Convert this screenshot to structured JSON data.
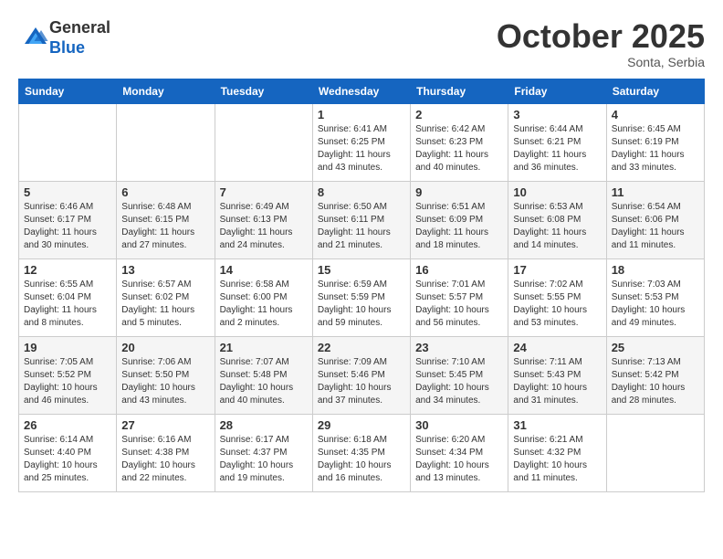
{
  "header": {
    "logo_line1": "General",
    "logo_line2": "Blue",
    "month_title": "October 2025",
    "location": "Sonta, Serbia"
  },
  "days_of_week": [
    "Sunday",
    "Monday",
    "Tuesday",
    "Wednesday",
    "Thursday",
    "Friday",
    "Saturday"
  ],
  "weeks": [
    [
      {
        "day": "",
        "info": ""
      },
      {
        "day": "",
        "info": ""
      },
      {
        "day": "",
        "info": ""
      },
      {
        "day": "1",
        "info": "Sunrise: 6:41 AM\nSunset: 6:25 PM\nDaylight: 11 hours\nand 43 minutes."
      },
      {
        "day": "2",
        "info": "Sunrise: 6:42 AM\nSunset: 6:23 PM\nDaylight: 11 hours\nand 40 minutes."
      },
      {
        "day": "3",
        "info": "Sunrise: 6:44 AM\nSunset: 6:21 PM\nDaylight: 11 hours\nand 36 minutes."
      },
      {
        "day": "4",
        "info": "Sunrise: 6:45 AM\nSunset: 6:19 PM\nDaylight: 11 hours\nand 33 minutes."
      }
    ],
    [
      {
        "day": "5",
        "info": "Sunrise: 6:46 AM\nSunset: 6:17 PM\nDaylight: 11 hours\nand 30 minutes."
      },
      {
        "day": "6",
        "info": "Sunrise: 6:48 AM\nSunset: 6:15 PM\nDaylight: 11 hours\nand 27 minutes."
      },
      {
        "day": "7",
        "info": "Sunrise: 6:49 AM\nSunset: 6:13 PM\nDaylight: 11 hours\nand 24 minutes."
      },
      {
        "day": "8",
        "info": "Sunrise: 6:50 AM\nSunset: 6:11 PM\nDaylight: 11 hours\nand 21 minutes."
      },
      {
        "day": "9",
        "info": "Sunrise: 6:51 AM\nSunset: 6:09 PM\nDaylight: 11 hours\nand 18 minutes."
      },
      {
        "day": "10",
        "info": "Sunrise: 6:53 AM\nSunset: 6:08 PM\nDaylight: 11 hours\nand 14 minutes."
      },
      {
        "day": "11",
        "info": "Sunrise: 6:54 AM\nSunset: 6:06 PM\nDaylight: 11 hours\nand 11 minutes."
      }
    ],
    [
      {
        "day": "12",
        "info": "Sunrise: 6:55 AM\nSunset: 6:04 PM\nDaylight: 11 hours\nand 8 minutes."
      },
      {
        "day": "13",
        "info": "Sunrise: 6:57 AM\nSunset: 6:02 PM\nDaylight: 11 hours\nand 5 minutes."
      },
      {
        "day": "14",
        "info": "Sunrise: 6:58 AM\nSunset: 6:00 PM\nDaylight: 11 hours\nand 2 minutes."
      },
      {
        "day": "15",
        "info": "Sunrise: 6:59 AM\nSunset: 5:59 PM\nDaylight: 10 hours\nand 59 minutes."
      },
      {
        "day": "16",
        "info": "Sunrise: 7:01 AM\nSunset: 5:57 PM\nDaylight: 10 hours\nand 56 minutes."
      },
      {
        "day": "17",
        "info": "Sunrise: 7:02 AM\nSunset: 5:55 PM\nDaylight: 10 hours\nand 53 minutes."
      },
      {
        "day": "18",
        "info": "Sunrise: 7:03 AM\nSunset: 5:53 PM\nDaylight: 10 hours\nand 49 minutes."
      }
    ],
    [
      {
        "day": "19",
        "info": "Sunrise: 7:05 AM\nSunset: 5:52 PM\nDaylight: 10 hours\nand 46 minutes."
      },
      {
        "day": "20",
        "info": "Sunrise: 7:06 AM\nSunset: 5:50 PM\nDaylight: 10 hours\nand 43 minutes."
      },
      {
        "day": "21",
        "info": "Sunrise: 7:07 AM\nSunset: 5:48 PM\nDaylight: 10 hours\nand 40 minutes."
      },
      {
        "day": "22",
        "info": "Sunrise: 7:09 AM\nSunset: 5:46 PM\nDaylight: 10 hours\nand 37 minutes."
      },
      {
        "day": "23",
        "info": "Sunrise: 7:10 AM\nSunset: 5:45 PM\nDaylight: 10 hours\nand 34 minutes."
      },
      {
        "day": "24",
        "info": "Sunrise: 7:11 AM\nSunset: 5:43 PM\nDaylight: 10 hours\nand 31 minutes."
      },
      {
        "day": "25",
        "info": "Sunrise: 7:13 AM\nSunset: 5:42 PM\nDaylight: 10 hours\nand 28 minutes."
      }
    ],
    [
      {
        "day": "26",
        "info": "Sunrise: 6:14 AM\nSunset: 4:40 PM\nDaylight: 10 hours\nand 25 minutes."
      },
      {
        "day": "27",
        "info": "Sunrise: 6:16 AM\nSunset: 4:38 PM\nDaylight: 10 hours\nand 22 minutes."
      },
      {
        "day": "28",
        "info": "Sunrise: 6:17 AM\nSunset: 4:37 PM\nDaylight: 10 hours\nand 19 minutes."
      },
      {
        "day": "29",
        "info": "Sunrise: 6:18 AM\nSunset: 4:35 PM\nDaylight: 10 hours\nand 16 minutes."
      },
      {
        "day": "30",
        "info": "Sunrise: 6:20 AM\nSunset: 4:34 PM\nDaylight: 10 hours\nand 13 minutes."
      },
      {
        "day": "31",
        "info": "Sunrise: 6:21 AM\nSunset: 4:32 PM\nDaylight: 10 hours\nand 11 minutes."
      },
      {
        "day": "",
        "info": ""
      }
    ]
  ]
}
